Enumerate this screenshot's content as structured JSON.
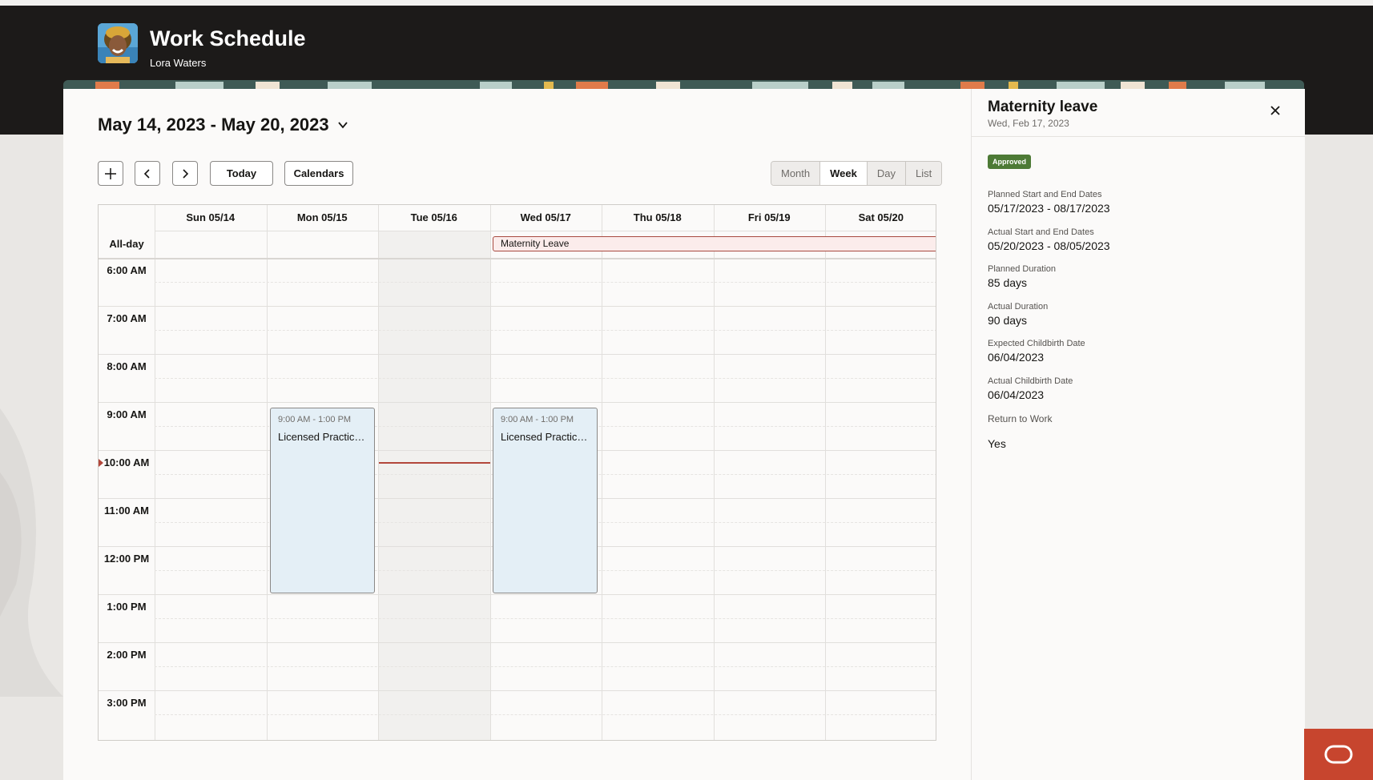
{
  "header": {
    "title": "Work Schedule",
    "subtitle": "Lora Waters"
  },
  "toolbar": {
    "date_range": "May 14, 2023 - May 20, 2023",
    "today_label": "Today",
    "calendars_label": "Calendars",
    "views": [
      "Month",
      "Week",
      "Day",
      "List"
    ],
    "active_view": "Week"
  },
  "calendar": {
    "days": [
      "Sun 05/14",
      "Mon 05/15",
      "Tue 05/16",
      "Wed 05/17",
      "Thu 05/18",
      "Fri 05/19",
      "Sat 05/20"
    ],
    "allday_label": "All-day",
    "times": [
      "6:00 AM",
      "7:00 AM",
      "8:00 AM",
      "9:00 AM",
      "10:00 AM",
      "11:00 AM",
      "12:00 PM",
      "1:00 PM",
      "2:00 PM",
      "3:00 PM"
    ],
    "allday_event": "Maternity Leave",
    "events": [
      {
        "time": "9:00 AM - 1:00 PM",
        "title": "Licensed Practical..."
      },
      {
        "time": "9:00 AM - 1:00 PM",
        "title": "Licensed Practical..."
      }
    ]
  },
  "panel": {
    "title": "Maternity leave",
    "subtitle": "Wed, Feb 17, 2023",
    "status": "Approved",
    "fields": [
      {
        "label": "Planned Start and End Dates",
        "value": "05/17/2023 - 08/17/2023"
      },
      {
        "label": "Actual Start and End Dates",
        "value": "05/20/2023 - 08/05/2023"
      },
      {
        "label": "Planned Duration",
        "value": "85 days"
      },
      {
        "label": "Actual Duration",
        "value": "90 days"
      },
      {
        "label": "Expected Childbirth Date",
        "value": "06/04/2023"
      },
      {
        "label": "Actual Childbirth Date",
        "value": "06/04/2023"
      },
      {
        "label": "Return to Work",
        "value": "Yes"
      }
    ]
  },
  "colors": {
    "header_bg": "#1c1a19",
    "event_bg": "#e4eff6",
    "allday_event_bg": "#fbeceb",
    "now_line": "#b3473b",
    "approved_badge": "#4d7a36",
    "help_button": "#c7452e"
  },
  "icons": {
    "add": "plus-icon",
    "prev": "chevron-left-icon",
    "next": "chevron-right-icon",
    "date_dropdown": "chevron-down-icon",
    "close": "close-icon",
    "help": "chat-icon"
  }
}
